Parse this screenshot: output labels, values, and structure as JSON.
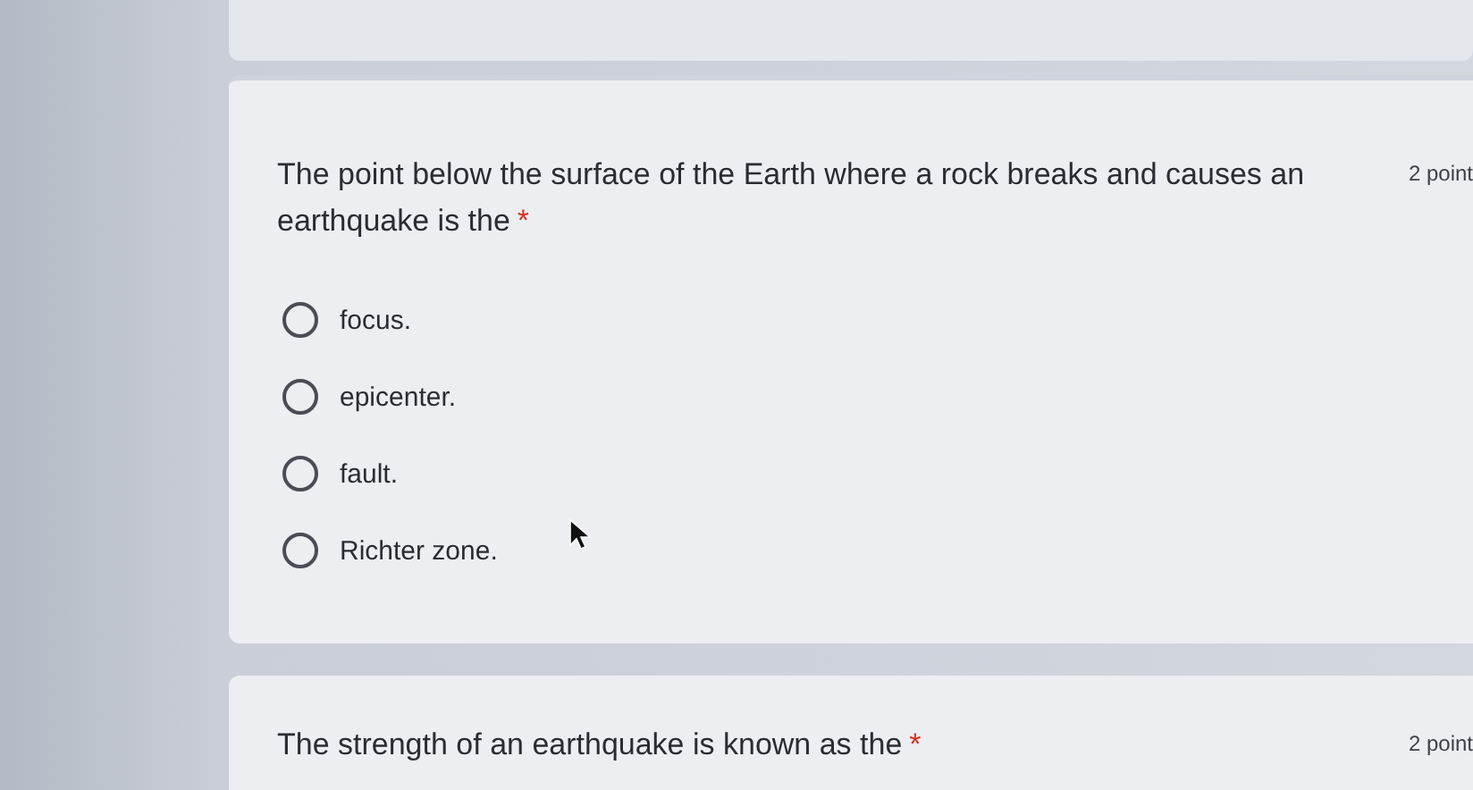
{
  "questions": [
    {
      "text": "The point below the surface of the Earth where a rock breaks and causes an earthquake is the",
      "required_mark": "*",
      "points": "2 point",
      "options": [
        {
          "label": "focus.",
          "selected": false
        },
        {
          "label": "epicenter.",
          "selected": false
        },
        {
          "label": "fault.",
          "selected": false
        },
        {
          "label": "Richter zone.",
          "selected": false
        }
      ]
    },
    {
      "text": "The strength of an earthquake is known as the",
      "required_mark": "*",
      "points": "2 point"
    }
  ]
}
